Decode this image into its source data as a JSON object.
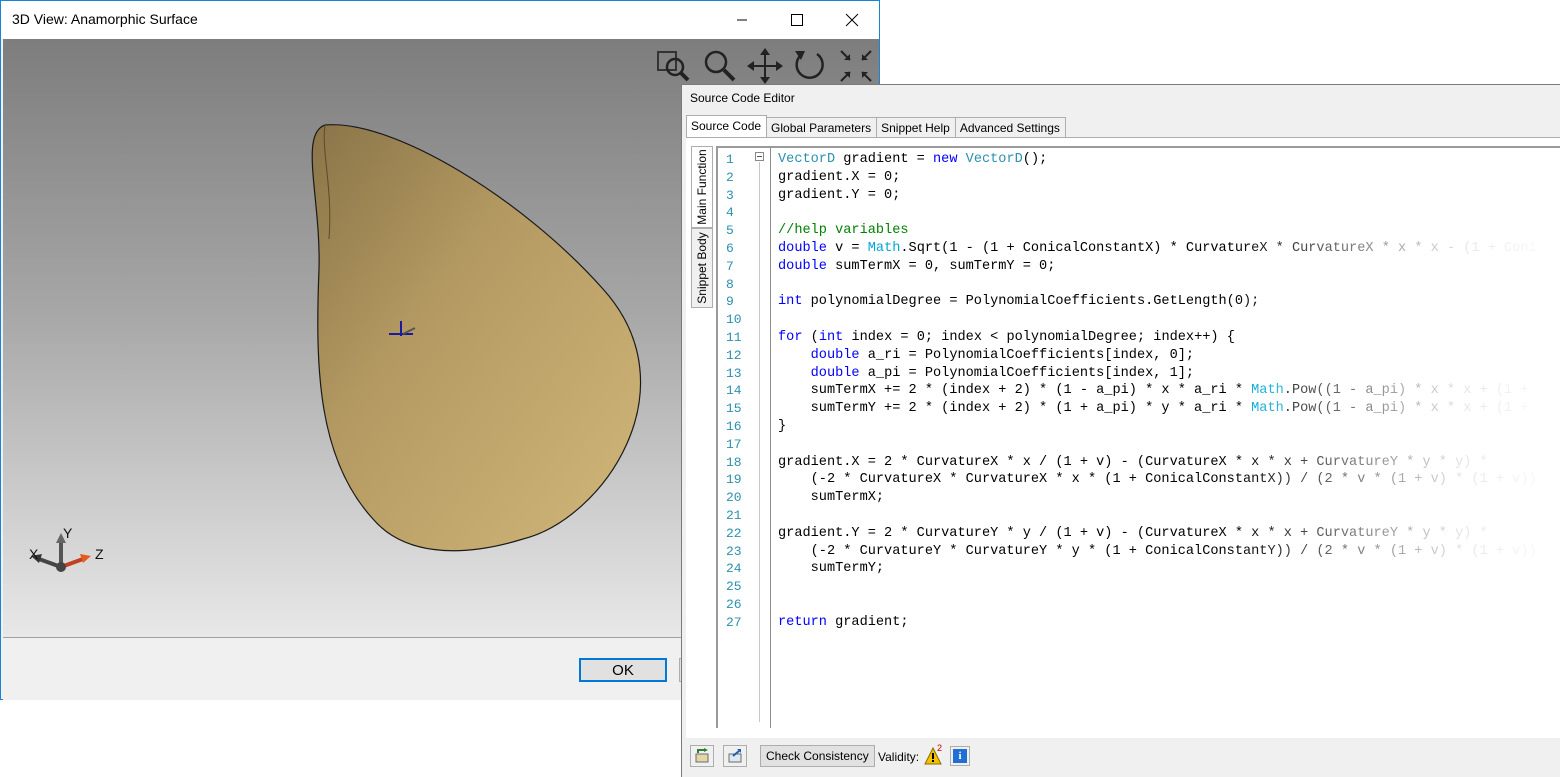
{
  "view3d": {
    "title": "3D View: Anamorphic Surface",
    "ok_label": "OK",
    "toolbar_icons": [
      "zoom-window-icon",
      "zoom-icon",
      "pan-icon",
      "rotate-icon",
      "fit-to-view-icon"
    ],
    "axes": {
      "x": "X",
      "y": "Y",
      "z": "Z"
    },
    "surface_color": "#c9ac6b",
    "background_top": "#7d7d7d",
    "background_bottom": "#e8e8e8"
  },
  "editor": {
    "title": "Source Code Editor",
    "tabs": [
      "Source Code",
      "Global Parameters",
      "Snippet Help",
      "Advanced Settings"
    ],
    "side_tabs": [
      "Main Function",
      "Snippet Body"
    ],
    "line_numbers": [
      "1",
      "2",
      "3",
      "4",
      "5",
      "6",
      "7",
      "8",
      "9",
      "10",
      "11",
      "12",
      "13",
      "14",
      "15",
      "16",
      "17",
      "18",
      "19",
      "20",
      "21",
      "22",
      "23",
      "24",
      "25",
      "26",
      "27"
    ],
    "code_lines": [
      "VectorD gradient = new VectorD();",
      "gradient.X = 0;",
      "gradient.Y = 0;",
      "",
      "//help variables",
      "double v = Math.Sqrt(1 - (1 + ConicalConstantX) * CurvatureX * CurvatureX * x * x - (1 + Coni",
      "double sumTermX = 0, sumTermY = 0;",
      "",
      "int polynomialDegree = PolynomialCoefficients.GetLength(0);",
      "",
      "for (int index = 0; index < polynomialDegree; index++) {",
      "    double a_ri = PolynomialCoefficients[index, 0];",
      "    double a_pi = PolynomialCoefficients[index, 1];",
      "    sumTermX += 2 * (index + 2) * (1 - a_pi) * x * a_ri * Math.Pow((1 - a_pi) * x * x + (1 +",
      "    sumTermY += 2 * (index + 2) * (1 + a_pi) * y * a_ri * Math.Pow((1 - a_pi) * x * x + (1 +",
      "}",
      "",
      "gradient.X = 2 * CurvatureX * x / (1 + v) - (CurvatureX * x * x + CurvatureY * y * y) *",
      "    (-2 * CurvatureX * CurvatureX * x * (1 + ConicalConstantX)) / (2 * v * (1 + v) * (1 + v))",
      "    sumTermX;",
      "",
      "gradient.Y = 2 * CurvatureY * y / (1 + v) - (CurvatureX * x * x + CurvatureY * y * y) *",
      "    (-2 * CurvatureY * CurvatureY * y * (1 + ConicalConstantY)) / (2 * v * (1 + v) * (1 + v))",
      "    sumTermY;",
      "",
      "",
      "return gradient;"
    ],
    "check_label": "Check Consistency",
    "validity_label": "Validity:",
    "warning_count": "2",
    "info_symbol": "i",
    "syntax_colors": {
      "keyword": "#0000ff",
      "type": "#2b91af",
      "comment": "#008000",
      "method": "#00a6d6",
      "line_number": "#2b91af"
    }
  }
}
